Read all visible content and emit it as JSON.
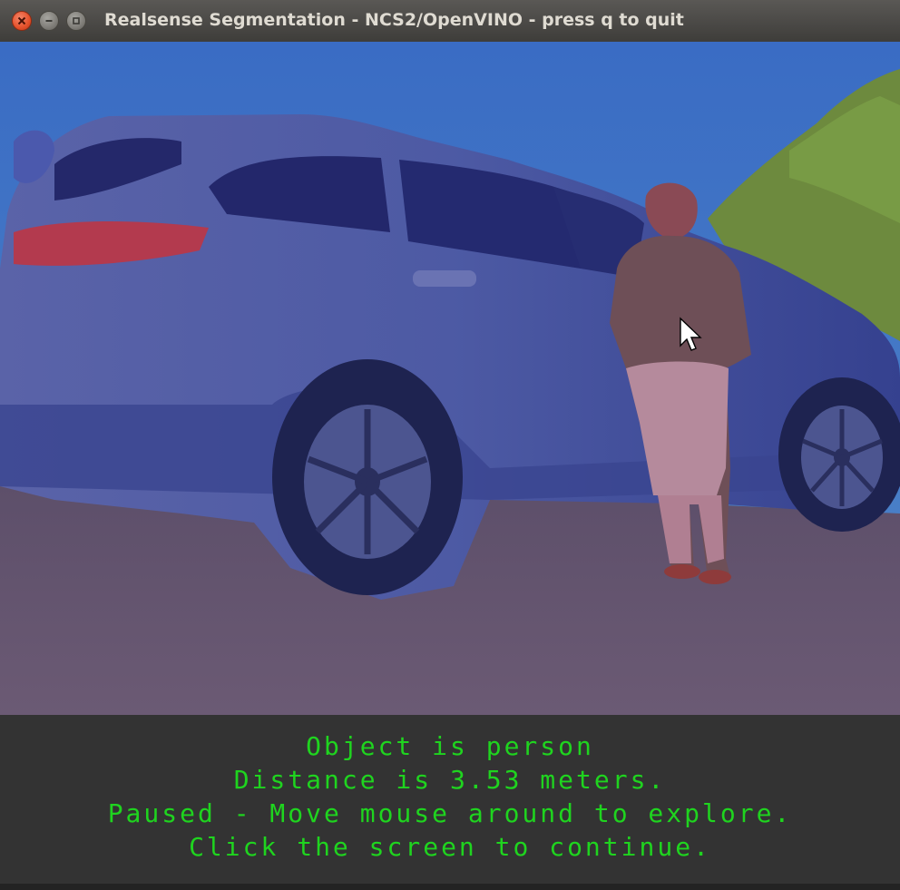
{
  "window": {
    "title": "Realsense Segmentation - NCS2/OpenVINO - press q to quit",
    "controls": {
      "close": "close-icon",
      "minimize": "minimize-icon",
      "maximize": "maximize-icon"
    }
  },
  "overlay": {
    "lines": [
      "Object is person",
      "Distance is 3.53 meters.",
      "Paused - Move mouse around to explore.",
      "Click the screen to continue."
    ],
    "text_color": "#1fd41f",
    "background": "#333333"
  },
  "segmentation": {
    "colors": {
      "sky": "#3f6ec0",
      "car": "#3c47a0",
      "person": "#c0392b",
      "road": "#7a5a78",
      "vegetation": "#6f8e3e"
    }
  },
  "cursor": "mouse-pointer-icon"
}
